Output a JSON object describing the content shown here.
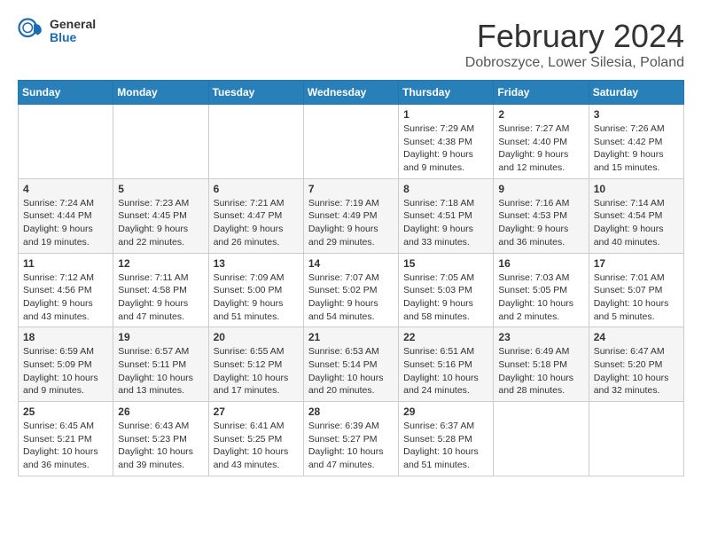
{
  "logo": {
    "general": "General",
    "blue": "Blue"
  },
  "title": "February 2024",
  "location": "Dobroszyce, Lower Silesia, Poland",
  "weekdays": [
    "Sunday",
    "Monday",
    "Tuesday",
    "Wednesday",
    "Thursday",
    "Friday",
    "Saturday"
  ],
  "weeks": [
    [
      {
        "day": "",
        "info": ""
      },
      {
        "day": "",
        "info": ""
      },
      {
        "day": "",
        "info": ""
      },
      {
        "day": "",
        "info": ""
      },
      {
        "day": "1",
        "info": "Sunrise: 7:29 AM\nSunset: 4:38 PM\nDaylight: 9 hours\nand 9 minutes."
      },
      {
        "day": "2",
        "info": "Sunrise: 7:27 AM\nSunset: 4:40 PM\nDaylight: 9 hours\nand 12 minutes."
      },
      {
        "day": "3",
        "info": "Sunrise: 7:26 AM\nSunset: 4:42 PM\nDaylight: 9 hours\nand 15 minutes."
      }
    ],
    [
      {
        "day": "4",
        "info": "Sunrise: 7:24 AM\nSunset: 4:44 PM\nDaylight: 9 hours\nand 19 minutes."
      },
      {
        "day": "5",
        "info": "Sunrise: 7:23 AM\nSunset: 4:45 PM\nDaylight: 9 hours\nand 22 minutes."
      },
      {
        "day": "6",
        "info": "Sunrise: 7:21 AM\nSunset: 4:47 PM\nDaylight: 9 hours\nand 26 minutes."
      },
      {
        "day": "7",
        "info": "Sunrise: 7:19 AM\nSunset: 4:49 PM\nDaylight: 9 hours\nand 29 minutes."
      },
      {
        "day": "8",
        "info": "Sunrise: 7:18 AM\nSunset: 4:51 PM\nDaylight: 9 hours\nand 33 minutes."
      },
      {
        "day": "9",
        "info": "Sunrise: 7:16 AM\nSunset: 4:53 PM\nDaylight: 9 hours\nand 36 minutes."
      },
      {
        "day": "10",
        "info": "Sunrise: 7:14 AM\nSunset: 4:54 PM\nDaylight: 9 hours\nand 40 minutes."
      }
    ],
    [
      {
        "day": "11",
        "info": "Sunrise: 7:12 AM\nSunset: 4:56 PM\nDaylight: 9 hours\nand 43 minutes."
      },
      {
        "day": "12",
        "info": "Sunrise: 7:11 AM\nSunset: 4:58 PM\nDaylight: 9 hours\nand 47 minutes."
      },
      {
        "day": "13",
        "info": "Sunrise: 7:09 AM\nSunset: 5:00 PM\nDaylight: 9 hours\nand 51 minutes."
      },
      {
        "day": "14",
        "info": "Sunrise: 7:07 AM\nSunset: 5:02 PM\nDaylight: 9 hours\nand 54 minutes."
      },
      {
        "day": "15",
        "info": "Sunrise: 7:05 AM\nSunset: 5:03 PM\nDaylight: 9 hours\nand 58 minutes."
      },
      {
        "day": "16",
        "info": "Sunrise: 7:03 AM\nSunset: 5:05 PM\nDaylight: 10 hours\nand 2 minutes."
      },
      {
        "day": "17",
        "info": "Sunrise: 7:01 AM\nSunset: 5:07 PM\nDaylight: 10 hours\nand 5 minutes."
      }
    ],
    [
      {
        "day": "18",
        "info": "Sunrise: 6:59 AM\nSunset: 5:09 PM\nDaylight: 10 hours\nand 9 minutes."
      },
      {
        "day": "19",
        "info": "Sunrise: 6:57 AM\nSunset: 5:11 PM\nDaylight: 10 hours\nand 13 minutes."
      },
      {
        "day": "20",
        "info": "Sunrise: 6:55 AM\nSunset: 5:12 PM\nDaylight: 10 hours\nand 17 minutes."
      },
      {
        "day": "21",
        "info": "Sunrise: 6:53 AM\nSunset: 5:14 PM\nDaylight: 10 hours\nand 20 minutes."
      },
      {
        "day": "22",
        "info": "Sunrise: 6:51 AM\nSunset: 5:16 PM\nDaylight: 10 hours\nand 24 minutes."
      },
      {
        "day": "23",
        "info": "Sunrise: 6:49 AM\nSunset: 5:18 PM\nDaylight: 10 hours\nand 28 minutes."
      },
      {
        "day": "24",
        "info": "Sunrise: 6:47 AM\nSunset: 5:20 PM\nDaylight: 10 hours\nand 32 minutes."
      }
    ],
    [
      {
        "day": "25",
        "info": "Sunrise: 6:45 AM\nSunset: 5:21 PM\nDaylight: 10 hours\nand 36 minutes."
      },
      {
        "day": "26",
        "info": "Sunrise: 6:43 AM\nSunset: 5:23 PM\nDaylight: 10 hours\nand 39 minutes."
      },
      {
        "day": "27",
        "info": "Sunrise: 6:41 AM\nSunset: 5:25 PM\nDaylight: 10 hours\nand 43 minutes."
      },
      {
        "day": "28",
        "info": "Sunrise: 6:39 AM\nSunset: 5:27 PM\nDaylight: 10 hours\nand 47 minutes."
      },
      {
        "day": "29",
        "info": "Sunrise: 6:37 AM\nSunset: 5:28 PM\nDaylight: 10 hours\nand 51 minutes."
      },
      {
        "day": "",
        "info": ""
      },
      {
        "day": "",
        "info": ""
      }
    ]
  ]
}
